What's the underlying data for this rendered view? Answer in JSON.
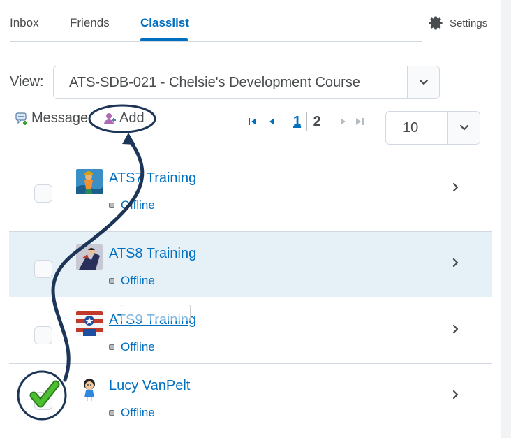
{
  "tabs": [
    {
      "label": "Inbox"
    },
    {
      "label": "Friends"
    },
    {
      "label": "Classlist"
    }
  ],
  "settings": {
    "label": "Settings",
    "icon": "gear-icon"
  },
  "view": {
    "label": "View:",
    "selected": "ATS-SDB-021 - Chelsie's Development Course"
  },
  "actions": {
    "message": "Message",
    "add": "Add"
  },
  "pagination": {
    "pages": [
      "1",
      "2"
    ],
    "current": "1",
    "per_page": "10"
  },
  "students": [
    {
      "name": "ATS7 Training",
      "status": "Offline",
      "checked": false,
      "avatar": "aquaman-avatar"
    },
    {
      "name": "ATS8 Training",
      "status": "Offline",
      "checked": false,
      "avatar": "superhero-avatar"
    },
    {
      "name": "ATS9 Training",
      "status": "Offline",
      "checked": false,
      "avatar": "captain-america-avatar"
    },
    {
      "name": "Lucy VanPelt",
      "status": "Offline",
      "checked": true,
      "avatar": "lucy-avatar"
    }
  ],
  "colors": {
    "accent": "#006fbf",
    "selected_row": "#e6f0f7",
    "annotation": "#1d3557",
    "check_green": "#3fa52a"
  }
}
